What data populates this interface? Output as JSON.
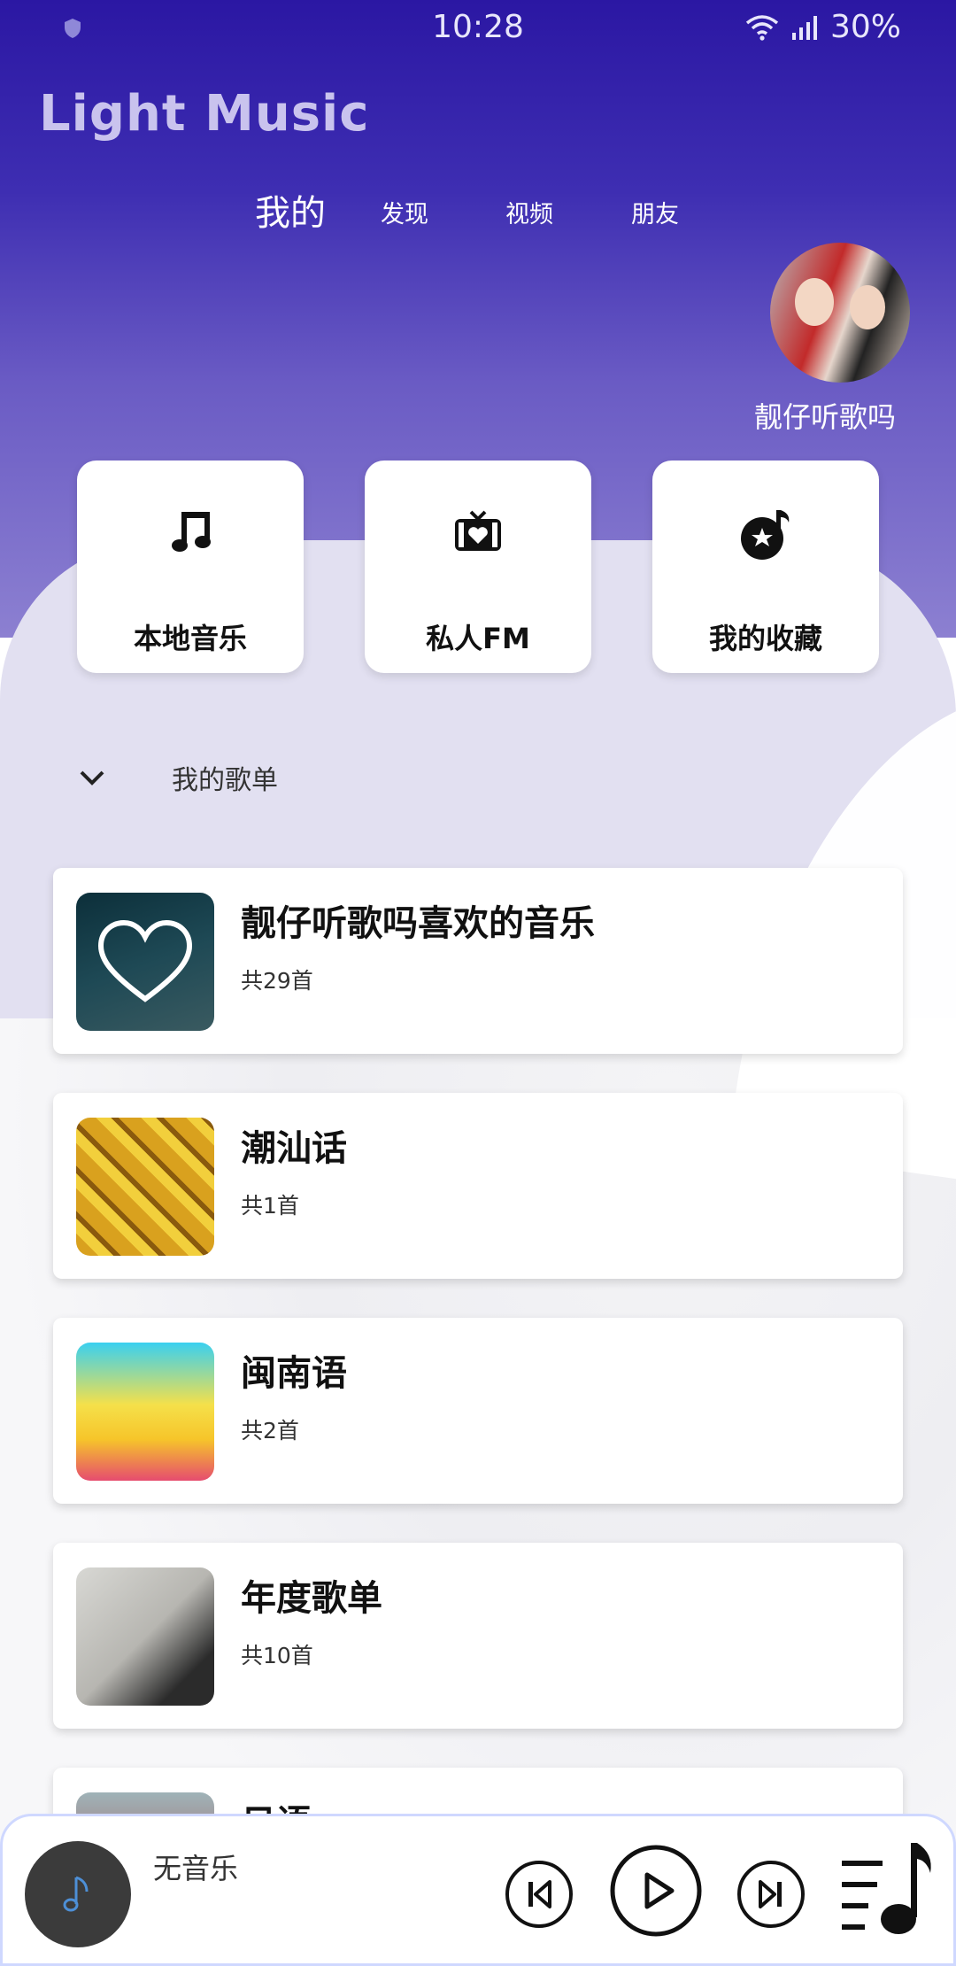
{
  "status_bar": {
    "time": "10:28",
    "battery": "30%"
  },
  "app": {
    "title": "Light Music"
  },
  "tabs": [
    {
      "label": "我的"
    },
    {
      "label": "发现"
    },
    {
      "label": "视频"
    },
    {
      "label": "朋友"
    }
  ],
  "user": {
    "name": "靓仔听歌吗"
  },
  "quick_actions": [
    {
      "label": "本地音乐",
      "icon": "music-note-icon"
    },
    {
      "label": "私人FM",
      "icon": "radio-icon"
    },
    {
      "label": "我的收藏",
      "icon": "collection-icon"
    }
  ],
  "section": {
    "title": "我的歌单"
  },
  "playlists": [
    {
      "name": "靓仔听歌吗喜欢的音乐",
      "count": "共29首"
    },
    {
      "name": "潮汕话",
      "count": "共1首"
    },
    {
      "name": "闽南语",
      "count": "共2首"
    },
    {
      "name": "年度歌单",
      "count": "共10首"
    },
    {
      "name": "日语",
      "count": ""
    }
  ],
  "player": {
    "title": "无音乐"
  }
}
